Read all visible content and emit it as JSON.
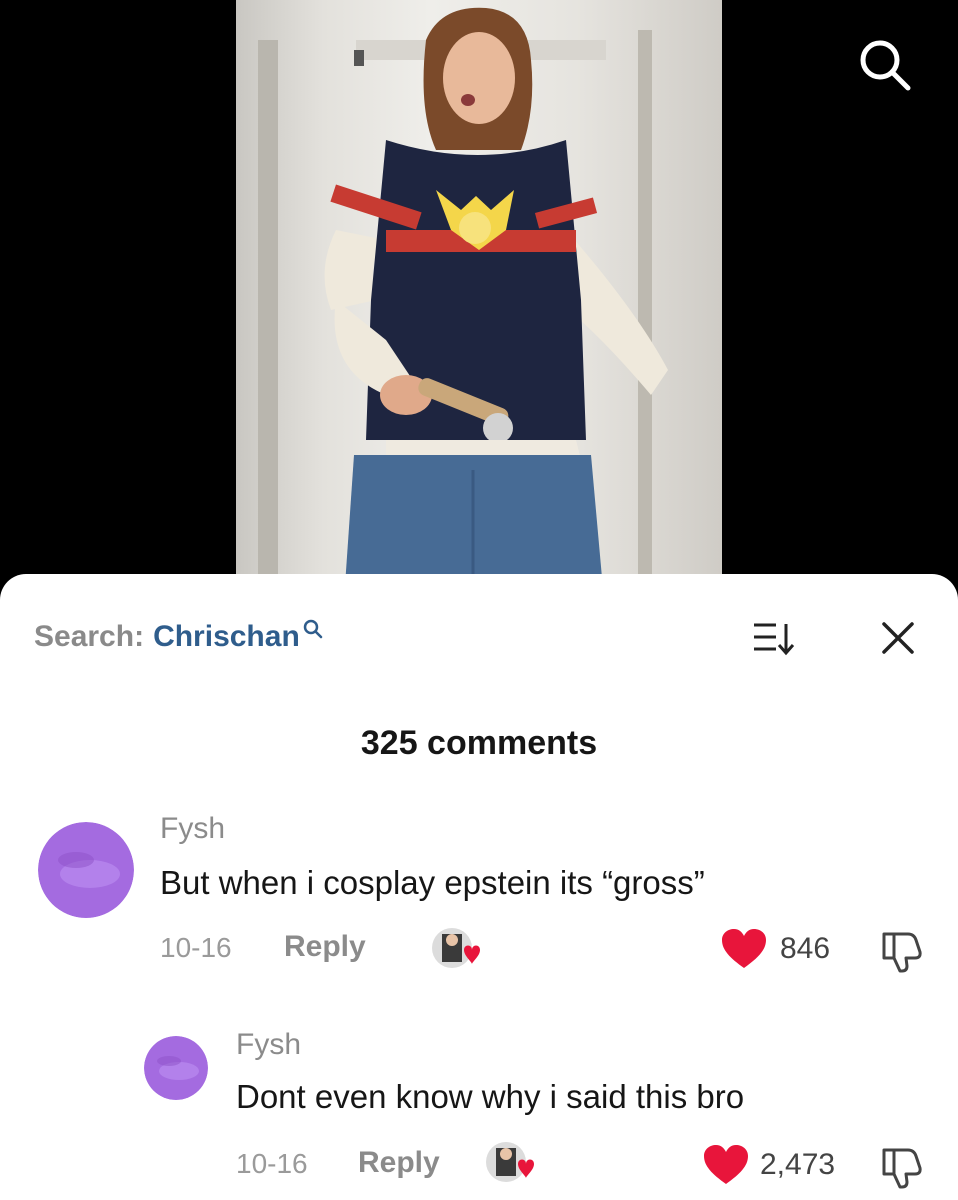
{
  "sheet": {
    "search_label": "Search:",
    "search_term": "Chrischan",
    "comments_count": "325 comments"
  },
  "icons": {
    "top_search": "search-icon",
    "sort": "sort-icon",
    "close": "close-icon",
    "like": "heart-icon",
    "dislike": "thumbs-down-icon"
  },
  "colors": {
    "accent_link": "#2f5d8c",
    "heart": "#e8153b",
    "avatar_purple": "#a46be0"
  },
  "comments": [
    {
      "username": "Fysh",
      "text": "But when i cosplay epstein its “gross”",
      "date": "10-16",
      "reply": "Reply",
      "likes": "846"
    },
    {
      "username": "Fysh",
      "text": "Dont even know why i said this bro",
      "date": "10-16",
      "reply": "Reply",
      "likes": "2,473"
    }
  ]
}
